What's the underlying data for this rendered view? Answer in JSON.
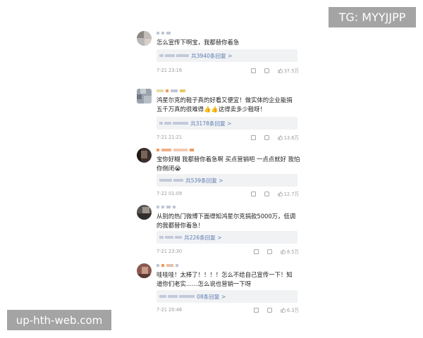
{
  "watermarks": {
    "top_right": "TG: MYYJJPP",
    "bottom_left": "up-hth-web.com"
  },
  "comments": [
    {
      "text": "怎么宣传下啊宝，我都替你着急",
      "replies": "共3940条回复 >",
      "time": "7-21 23:16",
      "likes": "37.5万",
      "avatar_colors": [
        "#b9b9b9",
        "#8d857e",
        "#d8cfc8"
      ]
    },
    {
      "text": "鸿星尔克的鞋子真的好看又便宜！做实体的企业能捐五千万真的很难得👍👍这得卖多少鞋呀！",
      "replies": "共3178条回复 >",
      "time": "7-21 21:21",
      "likes": "13.6万",
      "avatar_colors": [
        "#9aa3ad",
        "#c9ccd2",
        "#6f7883"
      ]
    },
    {
      "text": "宝你好糊 我都替你着急啊 买点营销吧 一点点就好 我怕你倒闭😭",
      "replies": "共539条回复 >",
      "time": "7-22 01:09",
      "likes": "12.7万",
      "avatar_colors": [
        "#3a302c",
        "#7a6458",
        "#1f1a18"
      ]
    },
    {
      "text": "从别的热门微博下面得知鸿星尔克捐款5000万，低调的我都替你着急！",
      "replies": "共226条回复 >",
      "time": "7-21 23:30",
      "likes": "8.5万",
      "avatar_colors": [
        "#5a5552",
        "#9d948c",
        "#322e2c"
      ]
    },
    {
      "text": "哇哇哇！太棒了！！！！怎么不给自己宣传一下！知道你们老实……怎么说也营销一下呀",
      "replies": "08条回复 >",
      "time": "7-21 20:46",
      "likes": "6.3万",
      "avatar_colors": [
        "#8a5a4e",
        "#c79a8a",
        "#5c3a33"
      ]
    }
  ]
}
